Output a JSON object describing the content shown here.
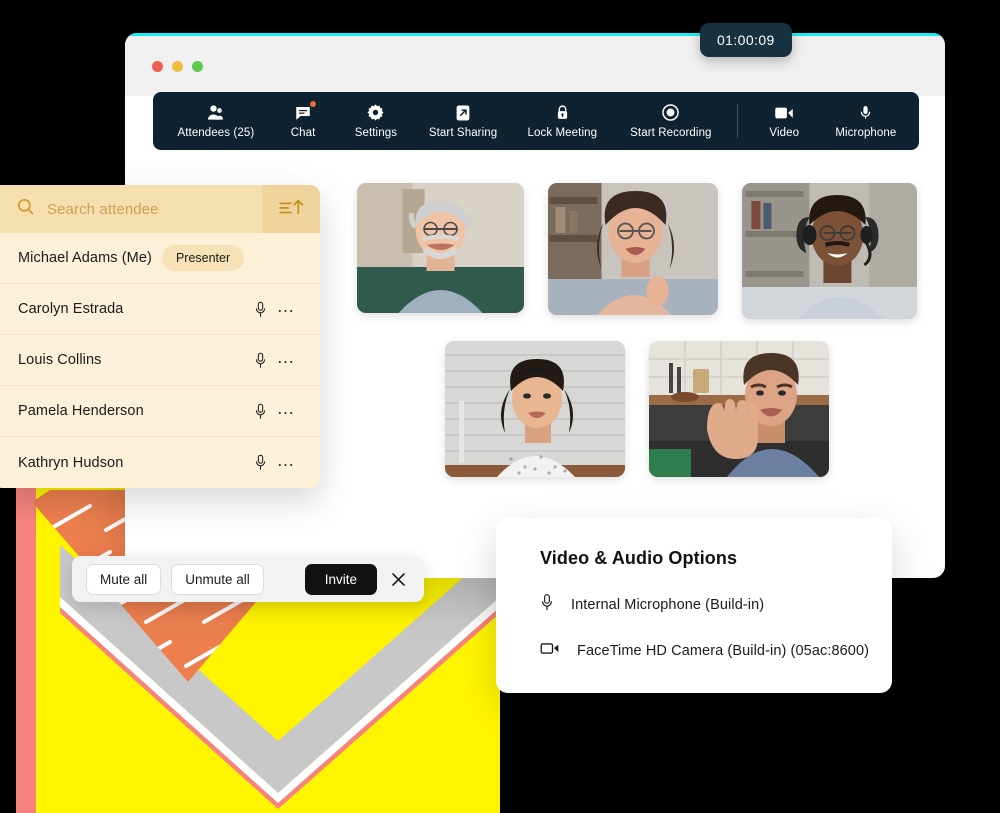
{
  "window": {
    "accent_color": "#16EFF5",
    "traffic_lights": [
      "close",
      "minimize",
      "zoom"
    ]
  },
  "timer": {
    "value": "01:00:09"
  },
  "toolbar": {
    "background": "#0E2231",
    "items": [
      {
        "icon": "attendees-icon",
        "label": "Attendees (25)",
        "badge": false
      },
      {
        "icon": "chat-icon",
        "label": "Chat",
        "badge": true
      },
      {
        "icon": "settings-gear-icon",
        "label": "Settings",
        "badge": false
      },
      {
        "icon": "share-screen-icon",
        "label": "Start Sharing",
        "badge": false
      },
      {
        "icon": "lock-icon",
        "label": "Lock Meeting",
        "badge": false
      },
      {
        "icon": "record-icon",
        "label": "Start Recording",
        "badge": false
      }
    ],
    "right_items": [
      {
        "icon": "video-camera-icon",
        "label": "Video"
      },
      {
        "icon": "microphone-icon",
        "label": "Microphone"
      }
    ]
  },
  "video_grid": {
    "row1": [
      {
        "name": "participant-tile-1"
      },
      {
        "name": "participant-tile-2"
      },
      {
        "name": "participant-tile-3"
      }
    ],
    "row2": [
      {
        "name": "participant-tile-4"
      },
      {
        "name": "participant-tile-5"
      }
    ]
  },
  "attendee_panel": {
    "background": "#FDF0D9",
    "search": {
      "placeholder": "Search attendee",
      "icon": "search-icon",
      "sort_icon": "sort-ascending-icon"
    },
    "rows": [
      {
        "name": "Michael Adams (Me)",
        "badge": "Presenter",
        "has_mic": false,
        "has_menu": false
      },
      {
        "name": "Carolyn Estrada",
        "badge": null,
        "has_mic": true,
        "has_menu": true
      },
      {
        "name": "Louis Collins",
        "badge": null,
        "has_mic": true,
        "has_menu": true
      },
      {
        "name": "Pamela Henderson",
        "badge": null,
        "has_mic": true,
        "has_menu": true
      },
      {
        "name": "Kathryn Hudson",
        "badge": null,
        "has_mic": true,
        "has_menu": true
      }
    ]
  },
  "mute_bar": {
    "mute_all_label": "Mute all",
    "unmute_all_label": "Unmute all",
    "invite_label": "Invite",
    "close_icon": "close-icon"
  },
  "options_card": {
    "title": "Video & Audio Options",
    "items": [
      {
        "icon": "microphone-icon",
        "label": "Internal Microphone (Build-in)"
      },
      {
        "icon": "video-camera-icon",
        "label": "FaceTime HD Camera (Build-in) (05ac:8600)"
      }
    ]
  },
  "decorations": {
    "yellow": "#FFF500",
    "pink": "#F8837E",
    "orange": "#ED7F4E",
    "gray": "#C8C8C8"
  }
}
